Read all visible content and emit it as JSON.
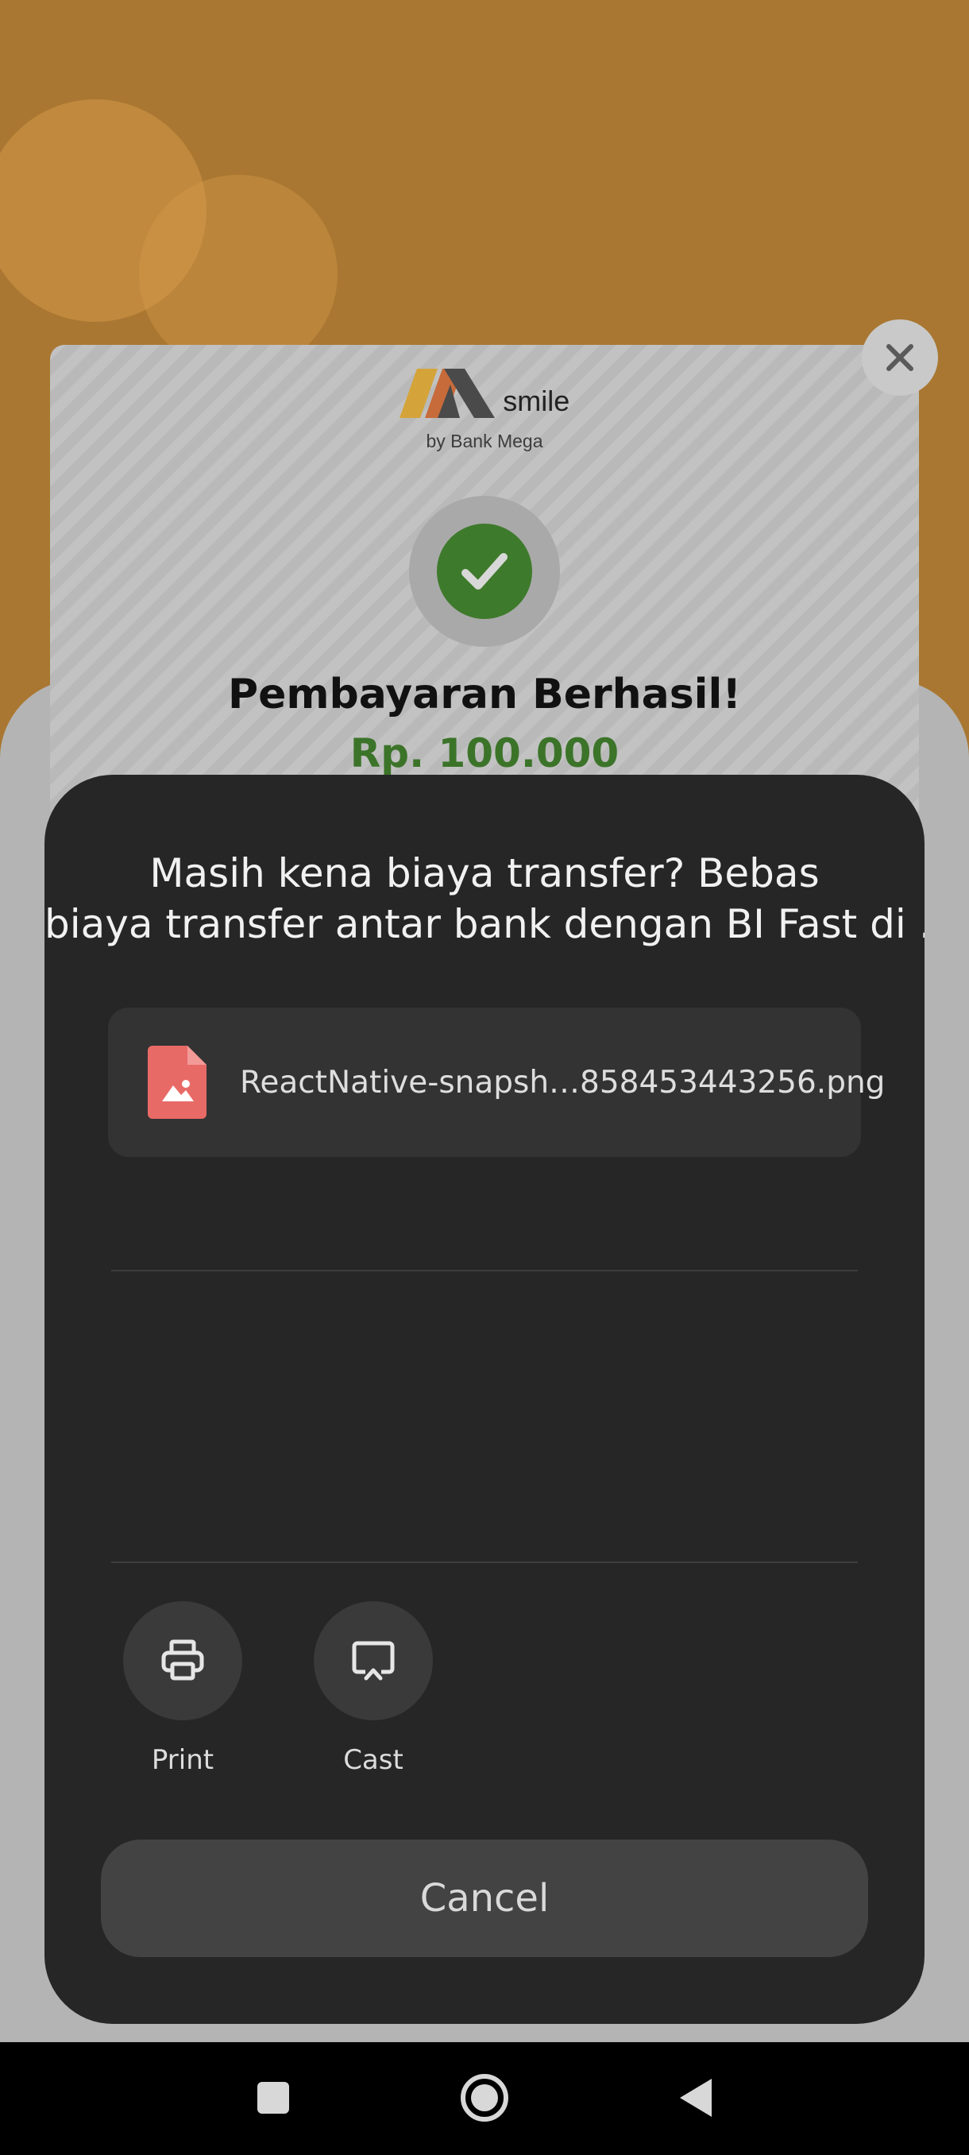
{
  "receipt": {
    "logo_text": "smile",
    "logo_sub": "by Bank Mega",
    "title": "Pembayaran Berhasil!",
    "amount": "Rp. 100.000"
  },
  "share_sheet": {
    "title_line1": "Masih kena biaya transfer? Bebas",
    "title_line2": "biaya transfer antar bank dengan BI Fast di …",
    "file_name": "ReactNative-snapsh…858453443256.png",
    "actions": [
      {
        "label": "Print",
        "icon": "print-icon"
      },
      {
        "label": "Cast",
        "icon": "cast-icon"
      }
    ],
    "cancel_label": "Cancel"
  },
  "colors": {
    "app_background": "#a97731",
    "success_green": "#3e7a2b",
    "sheet_background": "#262626",
    "file_icon": "#e86a67"
  },
  "navbar": {
    "icons": [
      "recent-apps-icon",
      "home-icon",
      "back-icon"
    ]
  }
}
